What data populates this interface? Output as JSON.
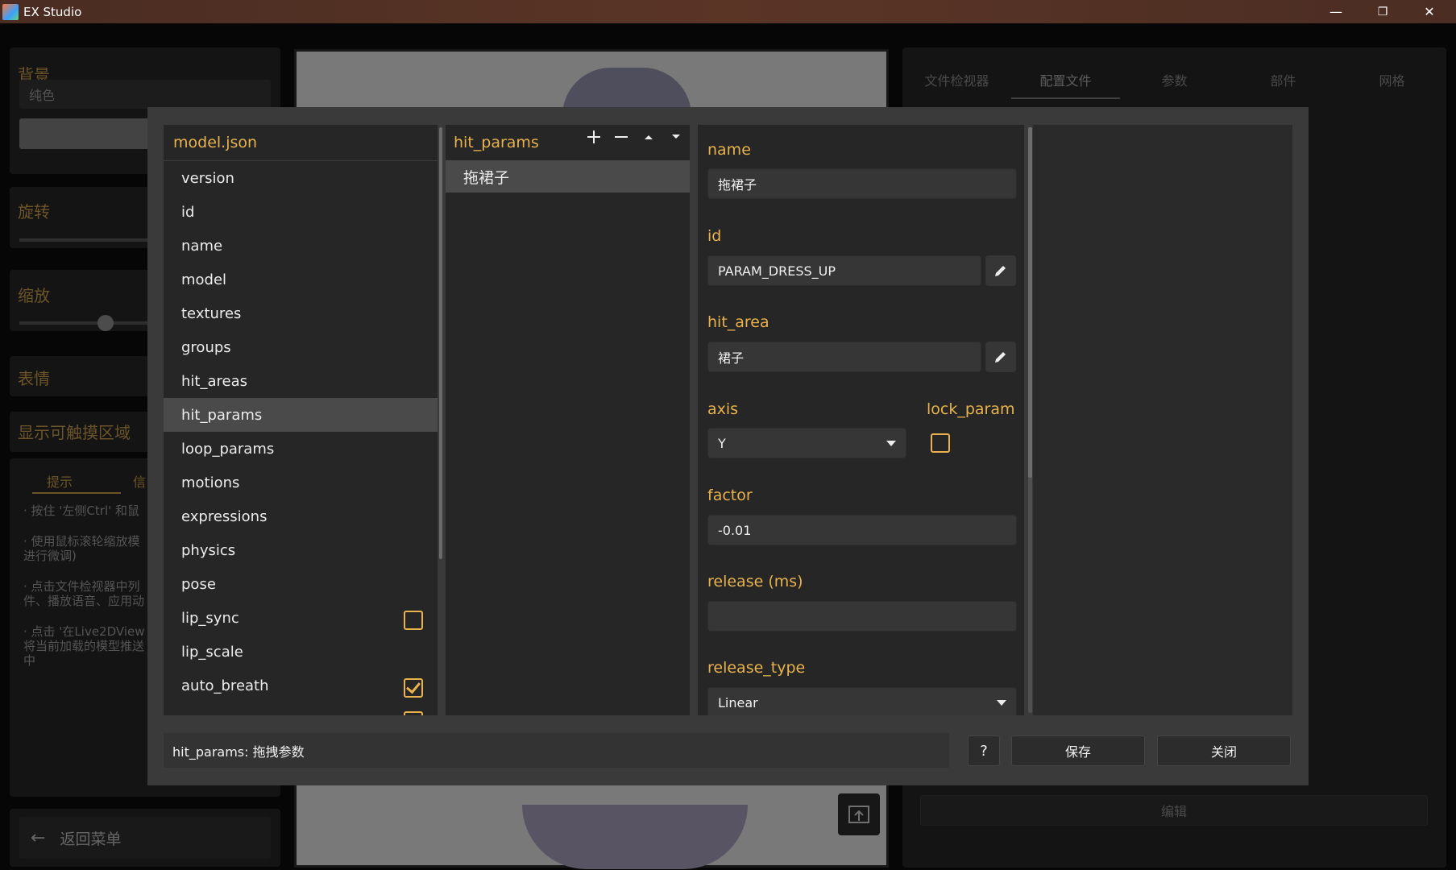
{
  "window": {
    "title": "EX Studio",
    "minimize": "—",
    "maximize": "❐",
    "close": "✕"
  },
  "background": {
    "left_sections": {
      "bg_title": "背景",
      "bg_mode": "纯色",
      "rotate_title": "旋转",
      "scale_title": "缩放",
      "expression_title": "表情",
      "show_hit_area": "显示可触摸区域",
      "tabs": [
        "提示",
        "信"
      ],
      "tips": [
        "· 按住 '左侧Ctrl' 和鼠",
        "· 使用鼠标滚轮缩放模",
        "进行微调)",
        "· 点击文件检视器中列",
        "件、播放语音、应用动",
        "· 点击 '在Live2DView",
        "将当前加载的模型推送",
        "中"
      ],
      "back_to_menu": "返回菜单"
    },
    "right_tabs": [
      "文件检视器",
      "配置文件",
      "参数",
      "部件",
      "网格"
    ],
    "right_active_tab": "配置文件",
    "edit_button": "编辑"
  },
  "dialog": {
    "tree": {
      "header": "model.json",
      "items": [
        "version",
        "id",
        "name",
        "model",
        "textures",
        "groups",
        "hit_areas",
        "hit_params",
        "loop_params",
        "motions",
        "expressions",
        "physics",
        "pose",
        "lip_sync",
        "lip_scale",
        "auto_breath"
      ],
      "selected": "hit_params",
      "lip_sync_checked": false,
      "auto_breath_checked": true
    },
    "list": {
      "header": "hit_params",
      "items": [
        "拖裙子"
      ],
      "selected": "拖裙子"
    },
    "form": {
      "name_label": "name",
      "name_value": "拖裙子",
      "id_label": "id",
      "id_value": "PARAM_DRESS_UP",
      "hit_area_label": "hit_area",
      "hit_area_value": "裙子",
      "axis_label": "axis",
      "axis_value": "Y",
      "lock_param_label": "lock_param",
      "lock_param_checked": false,
      "factor_label": "factor",
      "factor_value": "-0.01",
      "release_label": "release (ms)",
      "release_value": "",
      "release_type_label": "release_type",
      "release_type_value": "Linear"
    },
    "status_text": "hit_params: 拖拽参数",
    "help_label": "?",
    "save_label": "保存",
    "close_label": "关闭"
  },
  "colors": {
    "accent": "#e8b24c",
    "selection": "#4a4a4a",
    "dialog_bg": "#3a3a3a"
  }
}
